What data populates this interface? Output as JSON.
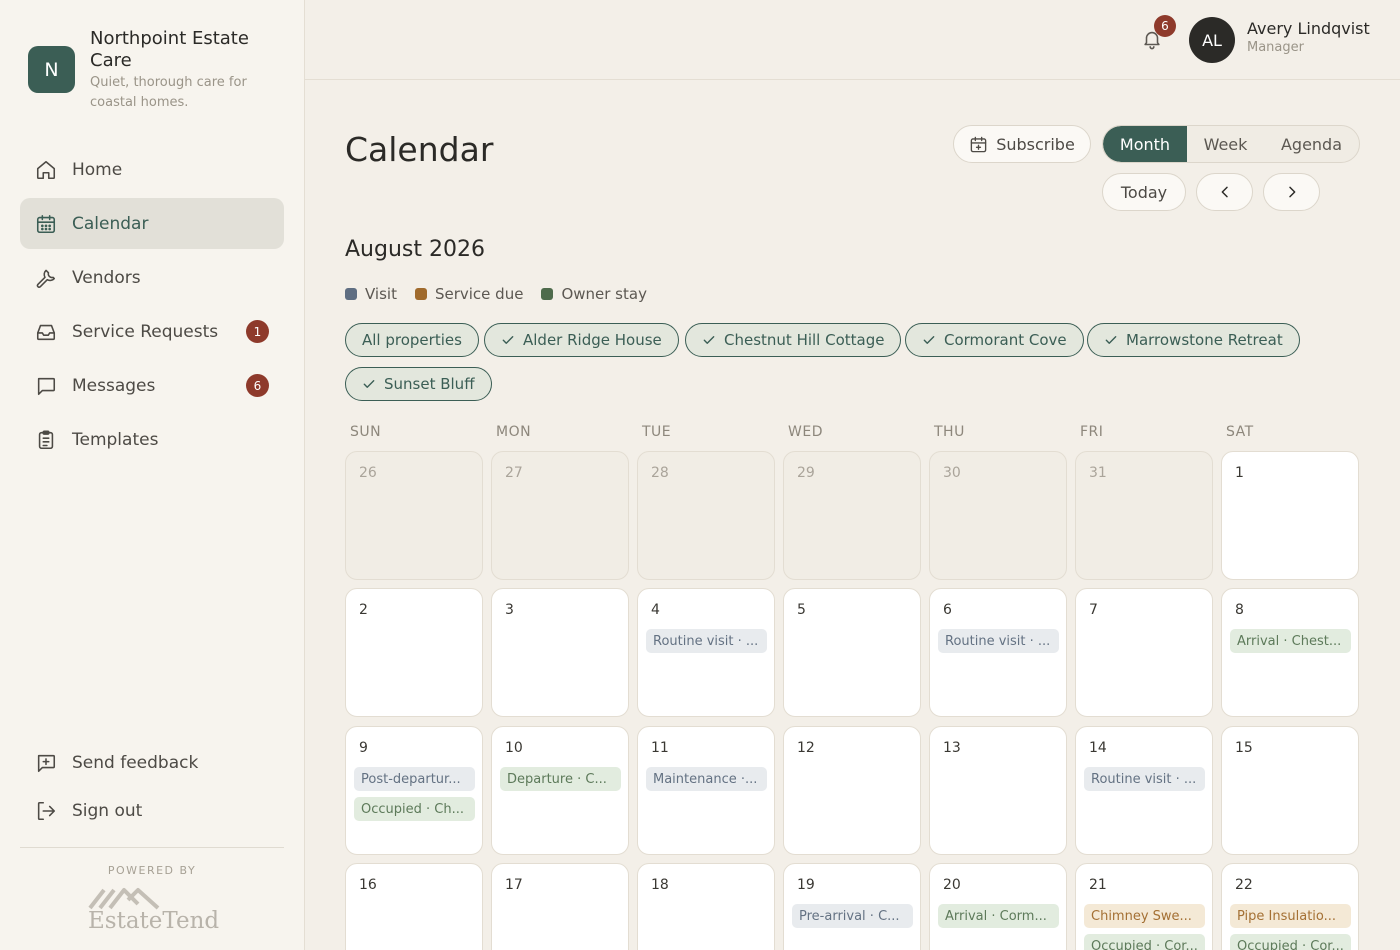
{
  "brand": {
    "initial": "N",
    "name": "Northpoint Estate Care",
    "tagline": "Quiet, thorough care for coastal homes."
  },
  "nav": {
    "items": [
      {
        "label": "Home",
        "icon": "home-icon"
      },
      {
        "label": "Calendar",
        "icon": "calendar-icon",
        "active": true
      },
      {
        "label": "Vendors",
        "icon": "wrench-icon"
      },
      {
        "label": "Service Requests",
        "icon": "inbox-icon",
        "badge": "1"
      },
      {
        "label": "Messages",
        "icon": "message-icon",
        "badge": "6"
      },
      {
        "label": "Templates",
        "icon": "clipboard-icon"
      }
    ],
    "feedback": "Send feedback",
    "signout": "Sign out"
  },
  "footer": {
    "powered_by": "POWERED BY",
    "product": "EstateTend"
  },
  "header": {
    "notification_count": "6",
    "avatar_initials": "AL",
    "user_name": "Avery Lindqvist",
    "user_role": "Manager"
  },
  "page": {
    "title": "Calendar",
    "subscribe": "Subscribe",
    "views": [
      "Month",
      "Week",
      "Agenda"
    ],
    "active_view": "Month",
    "today": "Today",
    "month_label": "August 2026"
  },
  "legend": [
    {
      "label": "Visit",
      "color": "#5f6e82"
    },
    {
      "label": "Service due",
      "color": "#a06a2c"
    },
    {
      "label": "Owner stay",
      "color": "#4e6b4c"
    }
  ],
  "filters": [
    "All properties",
    "Alder Ridge House",
    "Chestnut Hill Cottage",
    "Cormorant Cove",
    "Marrowstone Retreat",
    "Sunset Bluff"
  ],
  "weekdays": [
    "SUN",
    "MON",
    "TUE",
    "WED",
    "THU",
    "FRI",
    "SAT"
  ],
  "weeks": [
    [
      {
        "num": "26",
        "muted": true,
        "events": []
      },
      {
        "num": "27",
        "muted": true,
        "events": []
      },
      {
        "num": "28",
        "muted": true,
        "events": []
      },
      {
        "num": "29",
        "muted": true,
        "events": []
      },
      {
        "num": "30",
        "muted": true,
        "events": []
      },
      {
        "num": "31",
        "muted": true,
        "events": []
      },
      {
        "num": "1",
        "events": []
      }
    ],
    [
      {
        "num": "2",
        "events": []
      },
      {
        "num": "3",
        "events": []
      },
      {
        "num": "4",
        "events": [
          {
            "label": "Routine visit · ...",
            "kind": "visit"
          }
        ]
      },
      {
        "num": "5",
        "events": []
      },
      {
        "num": "6",
        "events": [
          {
            "label": "Routine visit · ...",
            "kind": "visit"
          }
        ]
      },
      {
        "num": "7",
        "events": []
      },
      {
        "num": "8",
        "events": [
          {
            "label": "Arrival · Chest...",
            "kind": "owner"
          }
        ]
      }
    ],
    [
      {
        "num": "9",
        "events": [
          {
            "label": "Post-departur...",
            "kind": "visit"
          },
          {
            "label": "Occupied · Ch...",
            "kind": "owner"
          }
        ]
      },
      {
        "num": "10",
        "events": [
          {
            "label": "Departure · C...",
            "kind": "owner"
          }
        ]
      },
      {
        "num": "11",
        "events": [
          {
            "label": "Maintenance ·...",
            "kind": "visit"
          }
        ]
      },
      {
        "num": "12",
        "events": []
      },
      {
        "num": "13",
        "events": []
      },
      {
        "num": "14",
        "events": [
          {
            "label": "Routine visit · ...",
            "kind": "visit"
          }
        ]
      },
      {
        "num": "15",
        "events": []
      }
    ],
    [
      {
        "num": "16",
        "events": []
      },
      {
        "num": "17",
        "events": []
      },
      {
        "num": "18",
        "events": []
      },
      {
        "num": "19",
        "events": [
          {
            "label": "Pre-arrival · C...",
            "kind": "visit"
          }
        ]
      },
      {
        "num": "20",
        "events": [
          {
            "label": "Arrival · Corm...",
            "kind": "owner"
          }
        ]
      },
      {
        "num": "21",
        "events": [
          {
            "label": "Chimney Swe...",
            "kind": "service"
          },
          {
            "label": "Occupied · Cor...",
            "kind": "owner"
          }
        ]
      },
      {
        "num": "22",
        "events": [
          {
            "label": "Pipe Insulatio...",
            "kind": "service"
          },
          {
            "label": "Occupied · Cor...",
            "kind": "owner"
          }
        ]
      }
    ]
  ]
}
